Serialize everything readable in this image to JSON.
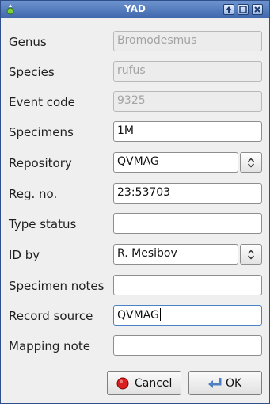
{
  "window": {
    "title": "YAD",
    "controls": [
      "up-icon",
      "minimize-icon",
      "close-icon"
    ]
  },
  "form": {
    "genus": {
      "label": "Genus",
      "value": "Bromodesmus",
      "state": "disabled"
    },
    "species": {
      "label": "Species",
      "value": "rufus",
      "state": "disabled"
    },
    "event_code": {
      "label": "Event code",
      "value": "9325",
      "state": "disabled"
    },
    "specimens": {
      "label": "Specimens",
      "value": "1M"
    },
    "repository": {
      "label": "Repository",
      "value": "QVMAG"
    },
    "reg_no": {
      "label": "Reg. no.",
      "value": "23:53703"
    },
    "type_status": {
      "label": "Type status",
      "value": ""
    },
    "id_by": {
      "label": "ID by",
      "value": "R. Mesibov"
    },
    "specimen_notes": {
      "label": "Specimen notes",
      "value": ""
    },
    "record_source": {
      "label": "Record source",
      "value": "QVMAG",
      "state": "focused"
    },
    "mapping_note": {
      "label": "Mapping note",
      "value": ""
    }
  },
  "buttons": {
    "cancel": {
      "label": "Cancel",
      "icon": "red-circle-icon"
    },
    "ok": {
      "label": "OK",
      "icon": "enter-arrow-icon"
    }
  },
  "colors": {
    "titlebar": "#3f67ab",
    "focus_border": "#4a82c8",
    "cancel_icon": "#d81e1e",
    "ok_icon": "#4f7fc0"
  }
}
